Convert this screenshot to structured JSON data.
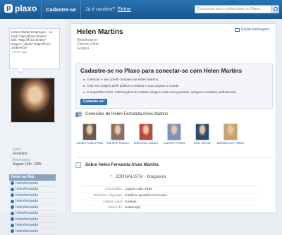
{
  "header": {
    "logo": "plaxo",
    "signup": "Cadastre-se",
    "already": "Já é usuário?",
    "enter": "Entrar",
    "search_placeholder": "Encontrar seus conhecidos no Plaxo"
  },
  "sidebar": {
    "status_text": "Helen Global Empregos - <a href=\"http://ff.im/-ZmEm\" title=\"http://ff.im/-ZmEm\" target=\"_blank\">http://ff.im/-ZmEm</a>",
    "status_ago": "1 hour ago",
    "sex_label": "Sexo",
    "sex_value": "Feminino",
    "birthday_label": "Aniversário",
    "birthday_value": "August 13th, 1985",
    "networks_title": "Helen na Web",
    "networks": [
      "helenfernanda",
      "helenfernanda",
      "helenfernanda",
      "helenfernanda",
      "helenfernanda",
      "helenfernanda",
      "helenfernanda",
      "helenfernanda",
      "helenfernanda"
    ]
  },
  "profile": {
    "name": "Helen Martins",
    "line1": "Webdesigner",
    "line2": "Ciência e Arte",
    "line3": "Goiânia",
    "send_message": "Enviar mensagem"
  },
  "signup_box": {
    "title": "Cadastre-se no Plaxo para conectar-se com Helen Martins",
    "items": [
      "Conectar e ver o perfil completo de Helen Martins",
      "Criar seu próprio perfil público e mostrar a sua carpora o mundo",
      "Compartilhar fotos, informações de contato, blogs e mais com parentes, amigos e contatos profissionais"
    ],
    "button": "Cadastre-se!"
  },
  "connections": {
    "title": "Conexões de Helen Fernanda Alves Martins",
    "people": [
      {
        "name": "Jander Caita Preta",
        "color": "#6b5a4c"
      },
      {
        "name": "Marlene Soares",
        "color": "#8a6f5c"
      },
      {
        "name": "Dobronay Lázaro",
        "color": "#b84a3a"
      },
      {
        "name": "Carmen Pralow",
        "color": "#7a93b8"
      },
      {
        "name": "John Jensen",
        "color": "#2f4a6a"
      },
      {
        "name": "Barbara von Tobien",
        "color": "#c9a36a"
      }
    ]
  },
  "about": {
    "title": "Sobre Helen Fernanda Alves Martins",
    "quote": "JORNALISTA - blogueira",
    "rows": [
      {
        "k": "Aniversário",
        "v": "August 13th, 1985"
      },
      {
        "k": "Opiniões religiosas",
        "v": "Católica Apostólica Romana"
      },
      {
        "k": "Cidade natal",
        "v": "Goiânia"
      },
      {
        "k": "Status de",
        "v": "Solteiro(a)"
      }
    ]
  }
}
